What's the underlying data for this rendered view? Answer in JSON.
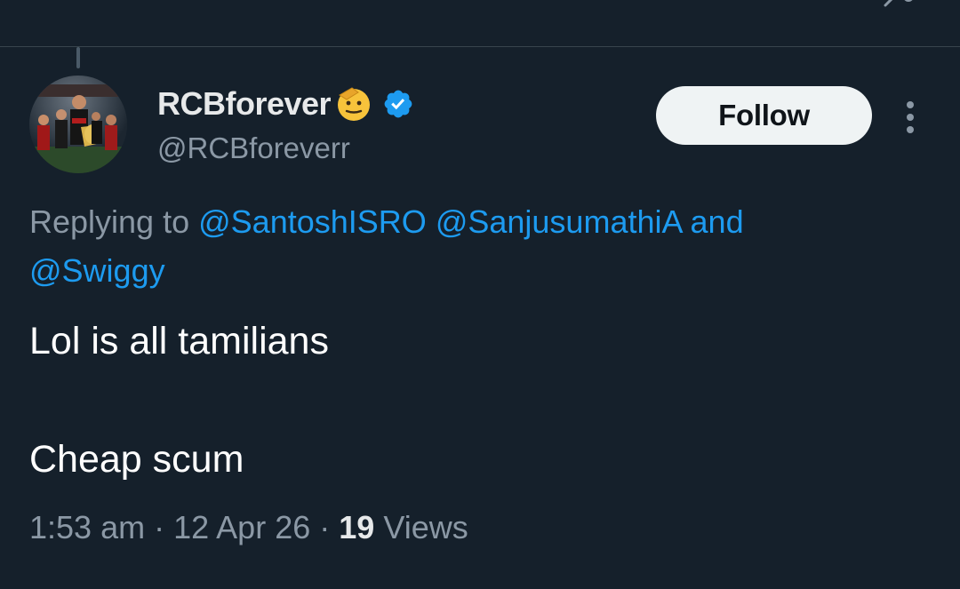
{
  "tweet": {
    "display_name": "RCBforever",
    "handle": "@RCBforeverr",
    "follow_label": "Follow",
    "reply_prefix": "Replying to",
    "reply_mentions": [
      "@SantoshISRO",
      "@SanjusumathiA"
    ],
    "reply_joiner": "and",
    "reply_last_mention": "@Swiggy",
    "text_line_1": "Lol is all tamilians",
    "text_line_2": "Cheap scum",
    "time": "1:53 am",
    "separator": "·",
    "date": "12 Apr 26",
    "views_count": "19",
    "views_label": "Views"
  },
  "icons": {
    "name_emoji": "saluting-face-emoji-icon",
    "verified": "verified-badge-icon",
    "more": "more-vertical-icon"
  },
  "colors": {
    "background": "#15202b",
    "text_primary": "#e7e9ea",
    "text_secondary": "#8b98a5",
    "link": "#1d9bf0",
    "follow_bg": "#eff3f4"
  }
}
